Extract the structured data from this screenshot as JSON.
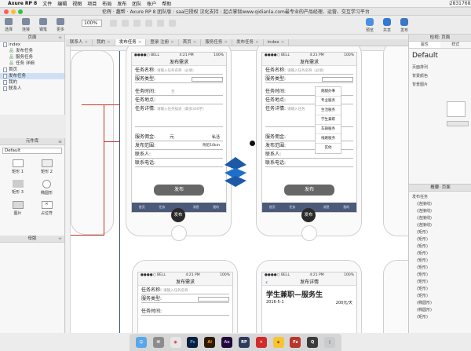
{
  "menubar": {
    "items": [
      "Axure RP 8",
      "文件",
      "编辑",
      "视图",
      "项目",
      "布局",
      "发布",
      "团队",
      "账户",
      "帮助"
    ],
    "phone": "2831768351"
  },
  "window": {
    "title": "伦辉 · 趣帮 · Axure RP 8 团队版 : saa已授权 汉化支持 : 起点掌狱www.qidianla.com最专业的产品经理、运营、交互学习平台"
  },
  "toolbar": {
    "left_buttons": [
      "选择",
      "连接",
      "钢笔",
      "更多"
    ],
    "zoom": "100%",
    "right_buttons": [
      "预览",
      "共享",
      "发布"
    ]
  },
  "pages_panel": {
    "title": "页面",
    "items": [
      {
        "label": "index",
        "level": 0
      },
      {
        "label": "发布任务",
        "level": 1
      },
      {
        "label": "服务任务",
        "level": 1
      },
      {
        "label": "任务 详细",
        "level": 1
      },
      {
        "label": "首页",
        "level": 0
      },
      {
        "label": "发布任务",
        "level": 0,
        "selected": true
      },
      {
        "label": "我的",
        "level": 0
      },
      {
        "label": "联系人",
        "level": 0
      }
    ]
  },
  "library_panel": {
    "title": "元件库",
    "selected": "Default",
    "widgets": [
      {
        "label": "矩形 1"
      },
      {
        "label": "矩形 2"
      },
      {
        "label": "矩形 3"
      },
      {
        "label": "椭圆形"
      },
      {
        "label": "图片"
      },
      {
        "label": "占位符"
      }
    ]
  },
  "masters_panel": {
    "title": "母版"
  },
  "tabs": [
    {
      "label": "联系人"
    },
    {
      "label": "我的"
    },
    {
      "label": "发布任务",
      "active": true
    },
    {
      "label": "登录 注册"
    },
    {
      "label": "首页"
    },
    {
      "label": "服务任务"
    },
    {
      "label": "发布任务"
    },
    {
      "label": "index"
    }
  ],
  "phone_left": {
    "status_carrier": "●●●●○ BELL",
    "status_time": "4:21 PM",
    "status_battery": "100%",
    "nav_title": "发布需求",
    "fields": [
      {
        "label": "任务名称:",
        "placeholder": "请输入任务名称（必填）"
      },
      {
        "label": "服务类型:",
        "placeholder": ""
      },
      {
        "label": "任务时间:",
        "placeholder": "至"
      },
      {
        "label": "任务地点:",
        "placeholder": ""
      },
      {
        "label": "任务详情:",
        "placeholder": "请输入任务描述（最多300字）"
      }
    ],
    "fee_label": "服务佣金:",
    "fee_unit": "元",
    "fee_extra": "私活",
    "range_label": "发布范围:",
    "range_value": "附近10km",
    "contact_label": "联系人:",
    "phone_label": "联系电话:",
    "publish_label": "发布",
    "fab_label": "发布"
  },
  "phone_right": {
    "status_carrier": "●●●●○ BELL",
    "status_time": "4:21 PM",
    "status_battery": "100%",
    "nav_title": "发布需求",
    "fields": [
      {
        "label": "任务名称:",
        "placeholder": "请输入任务名称（必填）"
      },
      {
        "label": "服务类型:",
        "placeholder": ""
      },
      {
        "label": "任务时间:",
        "placeholder": ""
      },
      {
        "label": "任务地点:",
        "placeholder": ""
      },
      {
        "label": "任务详情:",
        "placeholder": "请输入任务"
      }
    ],
    "fee_label": "服务佣金:",
    "range_label": "发布范围:",
    "contact_label": "联系人:",
    "phone_label": "联系电话:",
    "publish_label": "发布",
    "fab_label": "发布",
    "dropdown": [
      "跑腿办事",
      "专业服务",
      "生活服务",
      "学生兼职",
      "车辆服务",
      "线路服务",
      "其他"
    ]
  },
  "phone_bottom_left": {
    "status_carrier": "●●●●○ BELL",
    "status_time": "4:21 PM",
    "status_battery": "100%",
    "nav_title": "发布需求",
    "fields": [
      {
        "label": "任务名称:",
        "placeholder": "请输入任务名称"
      },
      {
        "label": "服务类型:",
        "placeholder": ""
      },
      {
        "label": "任务时间:",
        "placeholder": ""
      }
    ]
  },
  "phone_bottom_right": {
    "status_carrier": "●●●●○ BELL",
    "status_time": "4:21 PM",
    "status_battery": "100%",
    "nav_title": "发布详情",
    "back": "‹",
    "heading": "学生兼职—服务生",
    "date": "2016-5-1",
    "price": "200元/天"
  },
  "right_panel": {
    "header": "检视: 页面",
    "subtabs": [
      "属性",
      "样式"
    ],
    "style_name": "Default",
    "labels": [
      "页面排列",
      "背景颜色",
      "背景图片"
    ],
    "outline_title": "概要: 页面",
    "outline_items": [
      "发布任务",
      "(连接线)",
      "(连接线)",
      "(连接线)",
      "(连接线)",
      "(矩形)",
      "(矩形)",
      "(矩形)",
      "(矩形)",
      "(矩形)",
      "(矩形)",
      "(矩形)",
      "(矩形)",
      "(矩形)",
      "(矩形)",
      "(椭圆形)",
      "(椭圆形)",
      "(矩形)"
    ]
  },
  "dock_icons": [
    "finder",
    "launchpad",
    "chrome",
    "photoshop",
    "illustrator",
    "after-effects",
    "axure",
    "xmind",
    "sketch",
    "filezilla",
    "quicktime",
    "trash"
  ],
  "colors": {
    "tabbar": "#4c5a7a",
    "selection": "#cfe0f6",
    "connector": "#c0392b",
    "logo_blue": "#1c5aa8"
  }
}
